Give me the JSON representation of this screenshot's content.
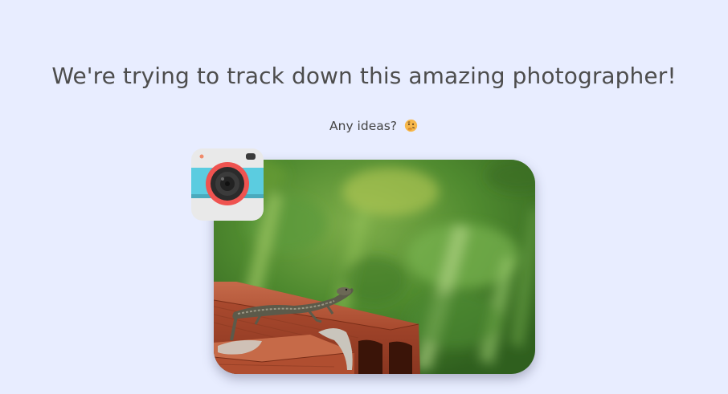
{
  "headline": "We're trying to track down this amazing photographer!",
  "subline": "Any ideas?",
  "icons": {
    "thinking": "thinking-face-icon",
    "camera": "camera-icon"
  },
  "colors": {
    "background": "#e8edff",
    "text": "#4d4d4d",
    "camera_red": "#ef5350",
    "camera_stripe": "#5bcce0"
  }
}
